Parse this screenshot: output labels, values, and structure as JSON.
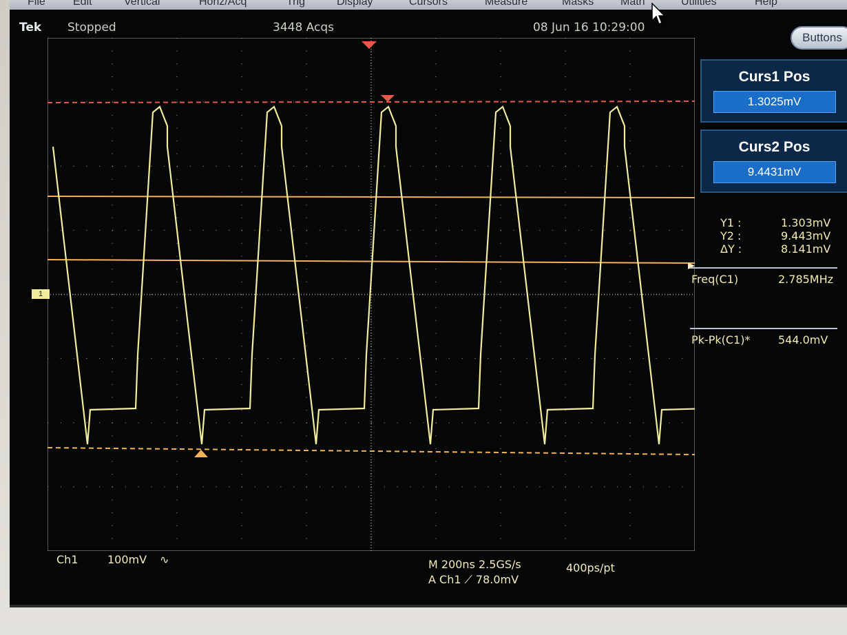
{
  "menu": [
    "File",
    "Edit",
    "Vertical",
    "Horiz/Acq",
    "Trig",
    "Display",
    "Cursors",
    "Measure",
    "Masks",
    "Math",
    "Utilities",
    "Help"
  ],
  "status": {
    "brand": "Tek",
    "state": "Stopped",
    "acquisitions": "3448 Acqs",
    "datetime": "08 Jun 16 10:29:00"
  },
  "buttons_label": "Buttons",
  "cursor1": {
    "title": "Curs1 Pos",
    "value": "1.3025mV"
  },
  "cursor2": {
    "title": "Curs2 Pos",
    "value": "9.4431mV"
  },
  "cursor_readout": [
    {
      "label": "Y1 :",
      "value": "1.303mV"
    },
    {
      "label": "Y2 :",
      "value": "9.443mV"
    },
    {
      "label": "ΔY :",
      "value": "8.141mV"
    }
  ],
  "measurements": [
    {
      "label": "Freq(C1)",
      "value": "2.785MHz"
    },
    {
      "label": "Pk-Pk(C1)*",
      "value": "544.0mV"
    }
  ],
  "channel": {
    "name": "Ch1",
    "scale": "100mV",
    "coupling_symbol": "∿"
  },
  "timebase": {
    "line1": "M 200ns 2.5GS/s",
    "line2": "A Ch1 ⟋ 78.0mV",
    "resolution": "400ps/pt"
  },
  "ground_marker": "1",
  "colors": {
    "trace": "#f0ec9e",
    "cursor": "#f2b35a",
    "trigger": "#e8584a",
    "grid": "#a8a8a0",
    "panel": "#0c2848"
  }
}
